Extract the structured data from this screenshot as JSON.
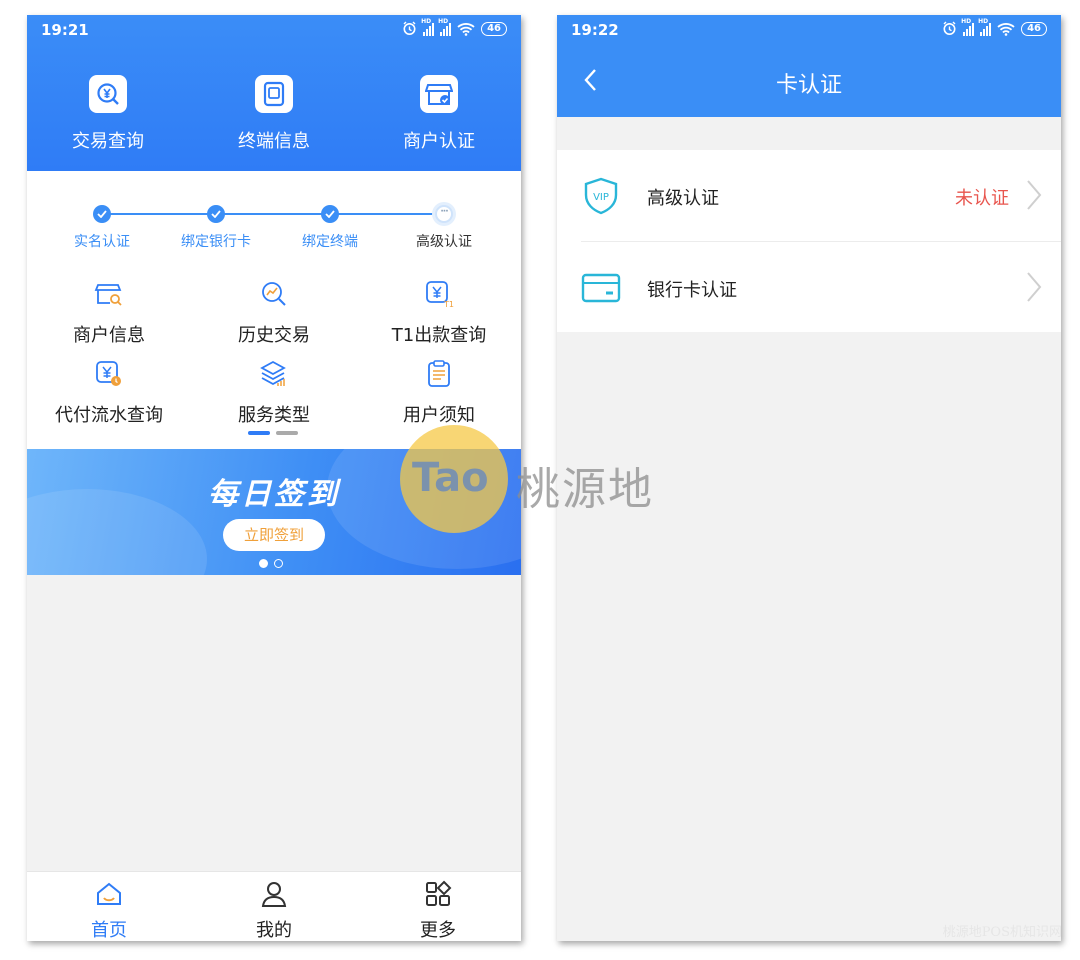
{
  "phone1": {
    "status": {
      "time": "19:21",
      "battery": "46"
    },
    "top_nav": [
      {
        "label": "交易查询",
        "icon": "yuan-search-icon"
      },
      {
        "label": "终端信息",
        "icon": "terminal-icon"
      },
      {
        "label": "商户认证",
        "icon": "store-verified-icon"
      }
    ],
    "steps": [
      {
        "label": "实名认证",
        "state": "done"
      },
      {
        "label": "绑定银行卡",
        "state": "done"
      },
      {
        "label": "绑定终端",
        "state": "done"
      },
      {
        "label": "高级认证",
        "state": "current",
        "glyph": "···"
      }
    ],
    "grid": [
      {
        "label": "商户信息",
        "icon": "store-search-icon"
      },
      {
        "label": "历史交易",
        "icon": "trend-search-icon"
      },
      {
        "label": "T1出款查询",
        "icon": "yuan-t1-icon"
      },
      {
        "label": "代付流水查询",
        "icon": "yuan-clock-icon"
      },
      {
        "label": "服务类型",
        "icon": "layers-icon"
      },
      {
        "label": "用户须知",
        "icon": "notice-icon"
      }
    ],
    "banner": {
      "title": "每日签到",
      "button": "立即签到"
    },
    "tabbar": [
      {
        "label": "首页",
        "icon": "home-icon",
        "active": true
      },
      {
        "label": "我的",
        "icon": "user-icon",
        "active": false
      },
      {
        "label": "更多",
        "icon": "more-grid-icon",
        "active": false
      }
    ]
  },
  "phone2": {
    "status": {
      "time": "19:22",
      "battery": "46"
    },
    "title": "卡认证",
    "rows": [
      {
        "label": "高级认证",
        "status": "未认证",
        "icon": "vip-shield-icon",
        "icon_text": "VIP"
      },
      {
        "label": "银行卡认证",
        "status": "",
        "icon": "bank-card-icon"
      }
    ]
  },
  "watermark": {
    "logo": "Tao",
    "name": "桃源地",
    "footer": "桃源地POS机知识网"
  },
  "colors": {
    "primary": "#2f7cf6",
    "alert": "#e8554e",
    "banner_button_text": "#f0a03a"
  }
}
